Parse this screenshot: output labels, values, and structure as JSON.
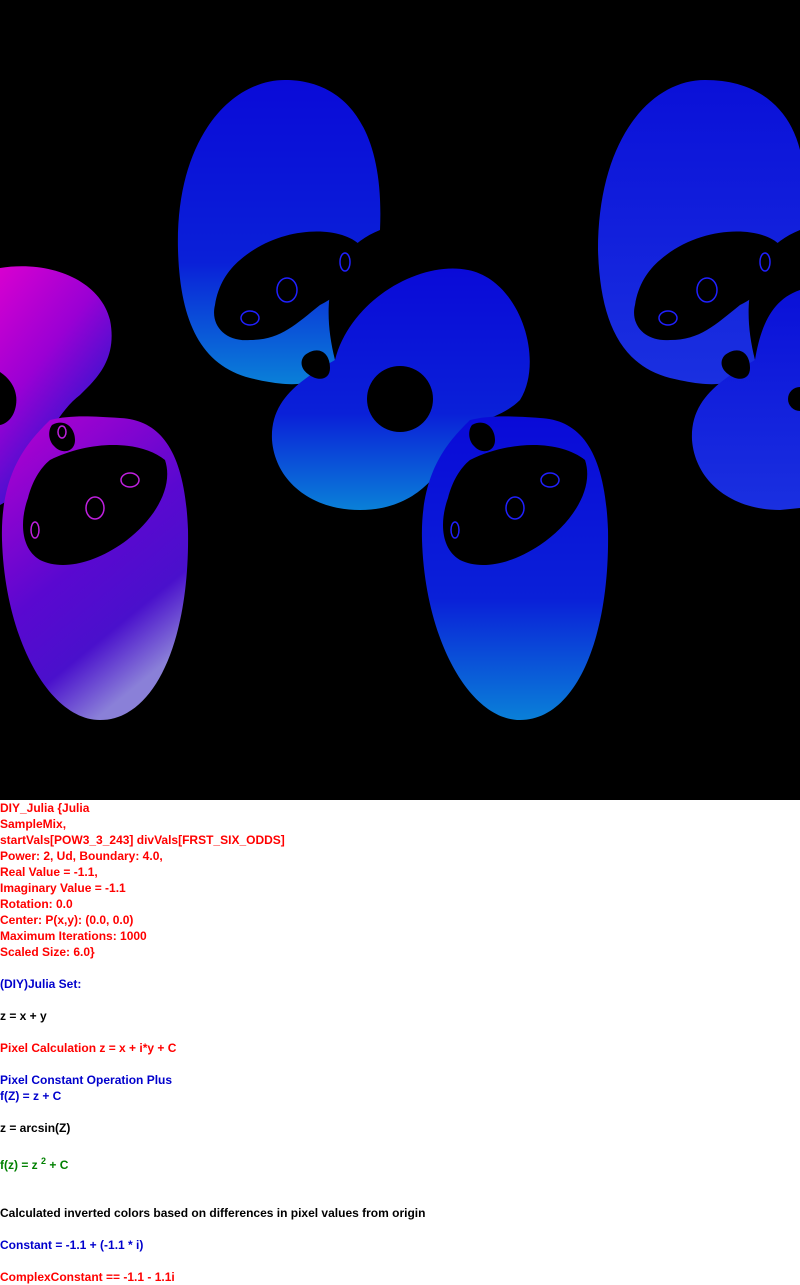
{
  "fractal": {
    "background": "#000000",
    "colors": {
      "body_blue": "#0a10d8",
      "magenta": "#d800d0",
      "light_blue": "#0a7ad8",
      "violet": "#7a2ad8",
      "hole": "#000000"
    }
  },
  "info": {
    "params": [
      "DIY_Julia {Julia",
      "SampleMix,",
      "startVals[POW3_3_243] divVals[FRST_SIX_ODDS]",
      "Power: 2, Ud, Boundary: 4.0,",
      "Real Value = -1.1,",
      "Imaginary Value = -1.1",
      "Rotation: 0.0",
      "Center: P(x,y): (0.0, 0.0)",
      "Maximum Iterations: 1000",
      "Scaled Size: 6.0}"
    ],
    "set_title": "(DIY)Julia Set:",
    "z_def": "z = x + y",
    "pixel_calc": "Pixel Calculation z = x + i*y + C",
    "pixel_const_op": "Pixel Constant Operation Plus",
    "f_Z": "f(Z) = z + C",
    "z_arcsin": "z = arcsin(Z)",
    "f_z_base": "f(z) = z",
    "f_z_exp": "2",
    "f_z_tail": " + C",
    "inverted_colors": "Calculated inverted colors based on differences in pixel values from origin",
    "constant": "Constant = -1.1 + (-1.1 * i)",
    "complex_constant": "ComplexConstant == -1.1 - 1.1i"
  }
}
